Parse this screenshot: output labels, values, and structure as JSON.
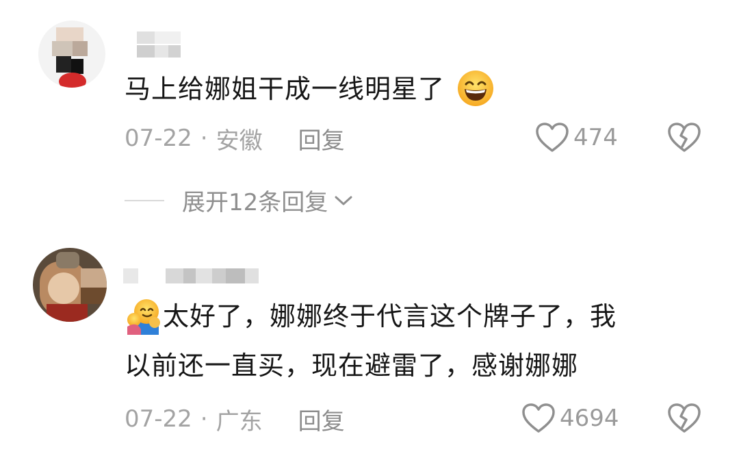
{
  "comments": [
    {
      "text_lines": [
        "马上给娜姐干成一线明星了"
      ],
      "emoji_suffix": "grinning-face-emoji",
      "date": "07-22",
      "location": "安徽",
      "reply_label": "回复",
      "like_count": "474",
      "expand_label": "展开12条回复"
    },
    {
      "emoji_prefix": "hugging-face-emoji",
      "text_lines": [
        "太好了，娜娜终于代言这个牌子了，我",
        "以前还一直买，现在避雷了，感谢娜娜"
      ],
      "date": "07-22",
      "location": "广东",
      "reply_label": "回复",
      "like_count": "4694"
    }
  ],
  "separator": "·",
  "icons": {
    "like": "heart-outline-icon",
    "dislike": "broken-heart-icon",
    "expand": "chevron-down-icon"
  },
  "colors": {
    "text": "#161616",
    "meta": "#a3a3a3",
    "icon": "#9a9a9a"
  }
}
